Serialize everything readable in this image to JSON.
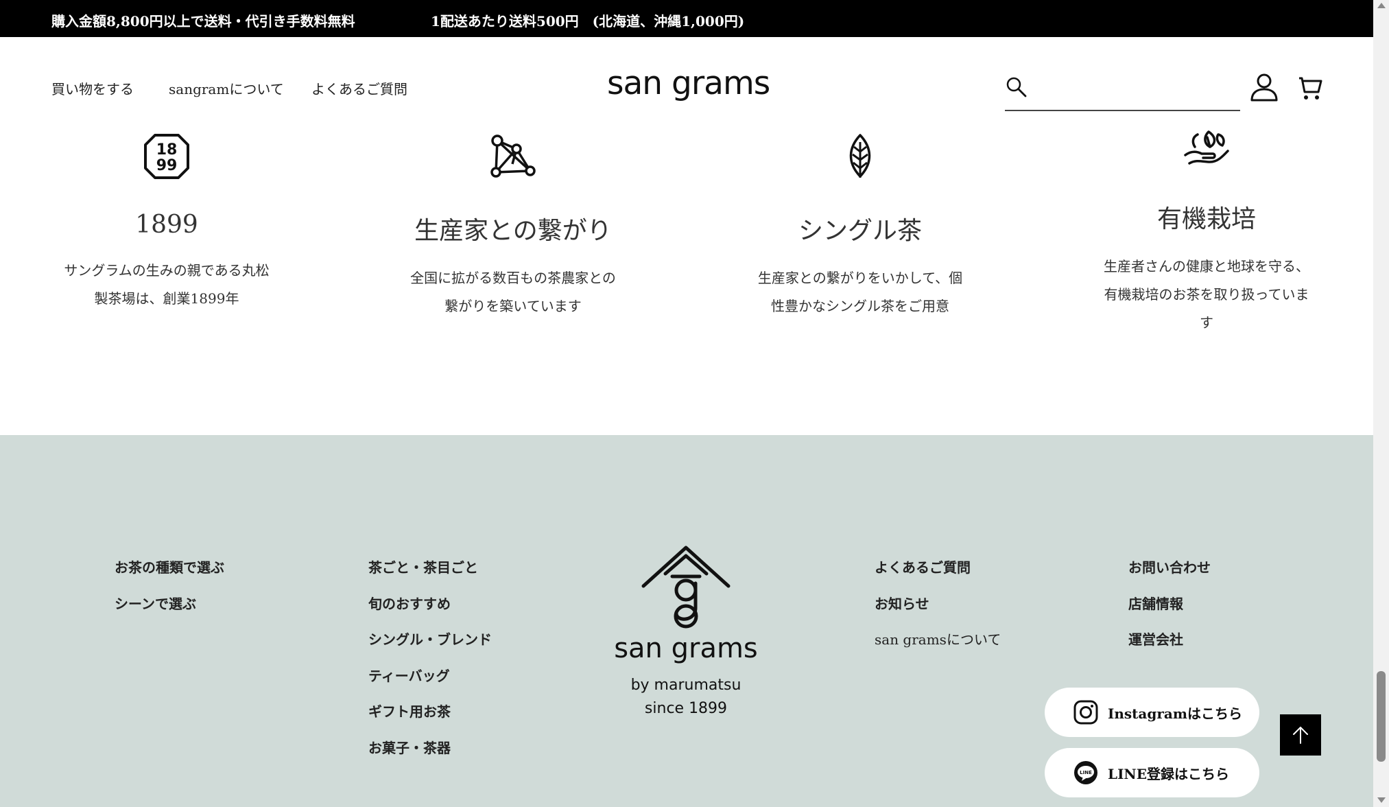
{
  "announcement": {
    "message1": "購入金額8,800円以上で送料・代引き手数料無料",
    "message2": "1配送あたり送料500円　(北海道、沖縄1,000円)"
  },
  "header": {
    "nav": [
      "買い物をする",
      "sangramについて",
      "よくあるご質問"
    ],
    "logo": "san grams",
    "search": {
      "placeholder": "",
      "value": ""
    },
    "icons": [
      "search-icon",
      "user-icon",
      "cart-icon"
    ]
  },
  "features": [
    {
      "icon": "1899-badge-icon",
      "title": "1899",
      "description": [
        "サングラムの生みの親である丸松",
        "製茶場は、創業1899年"
      ]
    },
    {
      "icon": "network-icon",
      "title": "生産家との繋がり",
      "description": [
        "全国に拡がる数百もの茶農家との",
        "繋がりを築いています"
      ]
    },
    {
      "icon": "leaf-icon",
      "title": "シングル茶",
      "description": [
        "生産家との繋がりをいかして、個",
        "性豊かなシングル茶をご用意"
      ]
    },
    {
      "icon": "hand-leaf-icon",
      "title": "有機栽培",
      "description": [
        "生産者さんの健康と地球を守る、",
        "有機栽培のお茶を取り扱っていま",
        "す"
      ]
    }
  ],
  "footer": {
    "col1": [
      "お茶の種類で選ぶ",
      "シーンで選ぶ"
    ],
    "col2": [
      "茶ごと・茶目ごと",
      "旬のおすすめ",
      "シングル・ブレンド",
      "ティーバッグ",
      "ギフト用お茶",
      "お菓子・茶器"
    ],
    "logo": {
      "wordmark": "san grams",
      "line1": "by marumatsu",
      "line2": "since 1899"
    },
    "col3": [
      "よくあるご質問",
      "お知らせ",
      "san gramsについて"
    ],
    "col4": [
      "お問い合わせ",
      "店舗情報",
      "運営会社"
    ],
    "instagram_label": "Instagramはこちら",
    "line_label": "LINE登録はこちら"
  },
  "colors": {
    "topbar": "#000000",
    "footer_bg": "#d0dbd8",
    "text": "#222222"
  }
}
